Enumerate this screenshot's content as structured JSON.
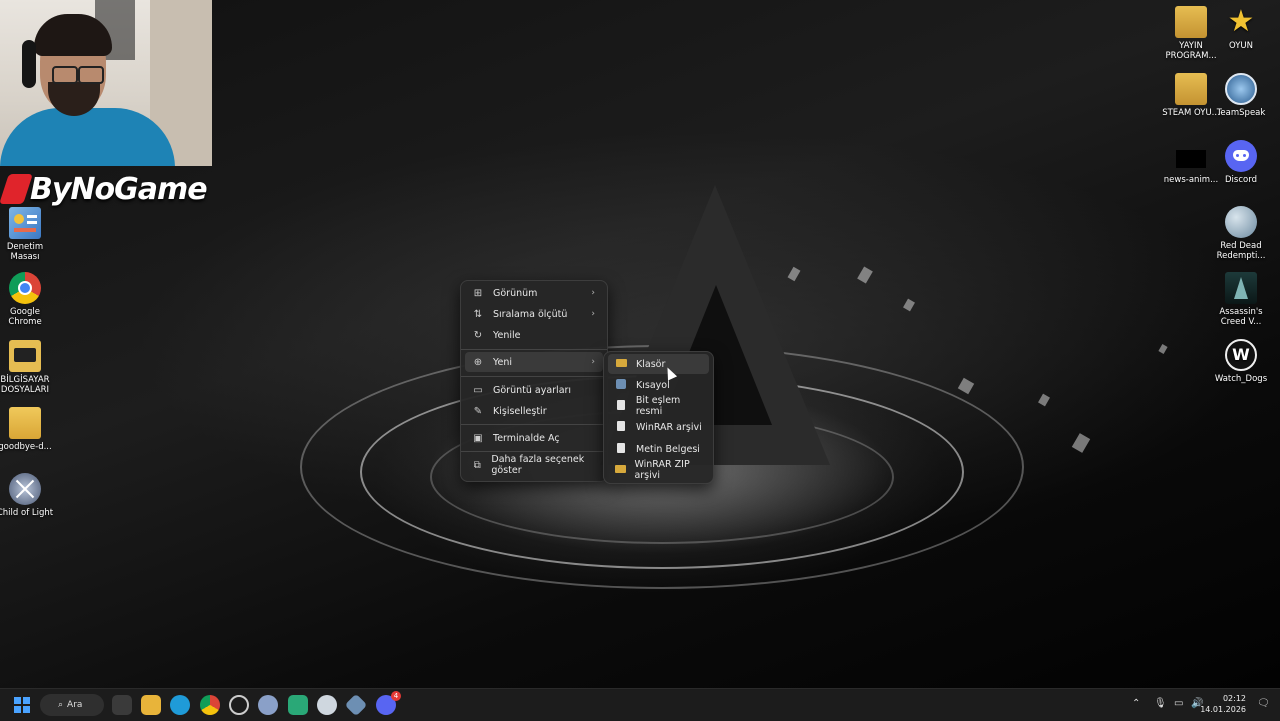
{
  "webcam": {
    "brand": "ByNoGame"
  },
  "desktop_icons_left": [
    {
      "label": "Denetim Masası",
      "icon": "control-panel-icon"
    },
    {
      "label": "Google Chrome",
      "icon": "chrome-icon"
    },
    {
      "label": "BİLGİSAYAR DOSYALARI",
      "icon": "folder-icon"
    },
    {
      "label": "goodbye-d...",
      "icon": "folder-icon"
    },
    {
      "label": "Child of Light",
      "icon": "game-icon"
    }
  ],
  "desktop_icons_right": [
    {
      "label": "YAYIN PROGRAM...",
      "icon": "folder-icon"
    },
    {
      "label": "OYUN",
      "icon": "star-icon"
    },
    {
      "label": "STEAM OYU...",
      "icon": "folder-icon"
    },
    {
      "label": "TeamSpeak",
      "icon": "teamspeak-icon"
    },
    {
      "label": "news-anim...",
      "icon": "file-icon"
    },
    {
      "label": "Discord",
      "icon": "discord-icon"
    },
    {
      "label": "Red Dead Redempti...",
      "icon": "game-icon"
    },
    {
      "label": "Assassin's Creed V...",
      "icon": "game-icon"
    },
    {
      "label": "Watch_Dogs",
      "icon": "game-icon"
    }
  ],
  "context_menu": {
    "items": [
      {
        "label": "Görünüm",
        "icon": "grid-icon",
        "submenu": true
      },
      {
        "label": "Sıralama ölçütü",
        "icon": "sort-icon",
        "submenu": true
      },
      {
        "label": "Yenile",
        "icon": "refresh-icon",
        "submenu": false
      },
      {
        "label": "Yeni",
        "icon": "plus-circle-icon",
        "submenu": true
      },
      {
        "label": "Görüntü ayarları",
        "icon": "display-icon",
        "submenu": false
      },
      {
        "label": "Kişiselleştir",
        "icon": "brush-icon",
        "submenu": false
      },
      {
        "label": "Terminalde Aç",
        "icon": "terminal-icon",
        "submenu": false
      },
      {
        "label": "Daha fazla seçenek göster",
        "icon": "more-icon",
        "submenu": false
      }
    ]
  },
  "submenu_new": {
    "items": [
      {
        "label": "Klasör",
        "icon": "folder-icon"
      },
      {
        "label": "Kısayol",
        "icon": "shortcut-icon"
      },
      {
        "label": "Bit eşlem resmi",
        "icon": "file-icon"
      },
      {
        "label": "WinRAR arşivi",
        "icon": "file-icon"
      },
      {
        "label": "Metin Belgesi",
        "icon": "file-icon"
      },
      {
        "label": "WinRAR ZIP arşivi",
        "icon": "folder-icon"
      }
    ]
  },
  "taskbar": {
    "search_label": "Ara",
    "discord_badge": "4",
    "time": "02:12",
    "date": "14.01.2026",
    "colors": {
      "start": "#4aa3ff",
      "files": "#e8b43a",
      "edge": "#1f9bd8",
      "chrome": "#e0442c",
      "steam": "#cfd7df",
      "discord": "#5865f2"
    }
  }
}
